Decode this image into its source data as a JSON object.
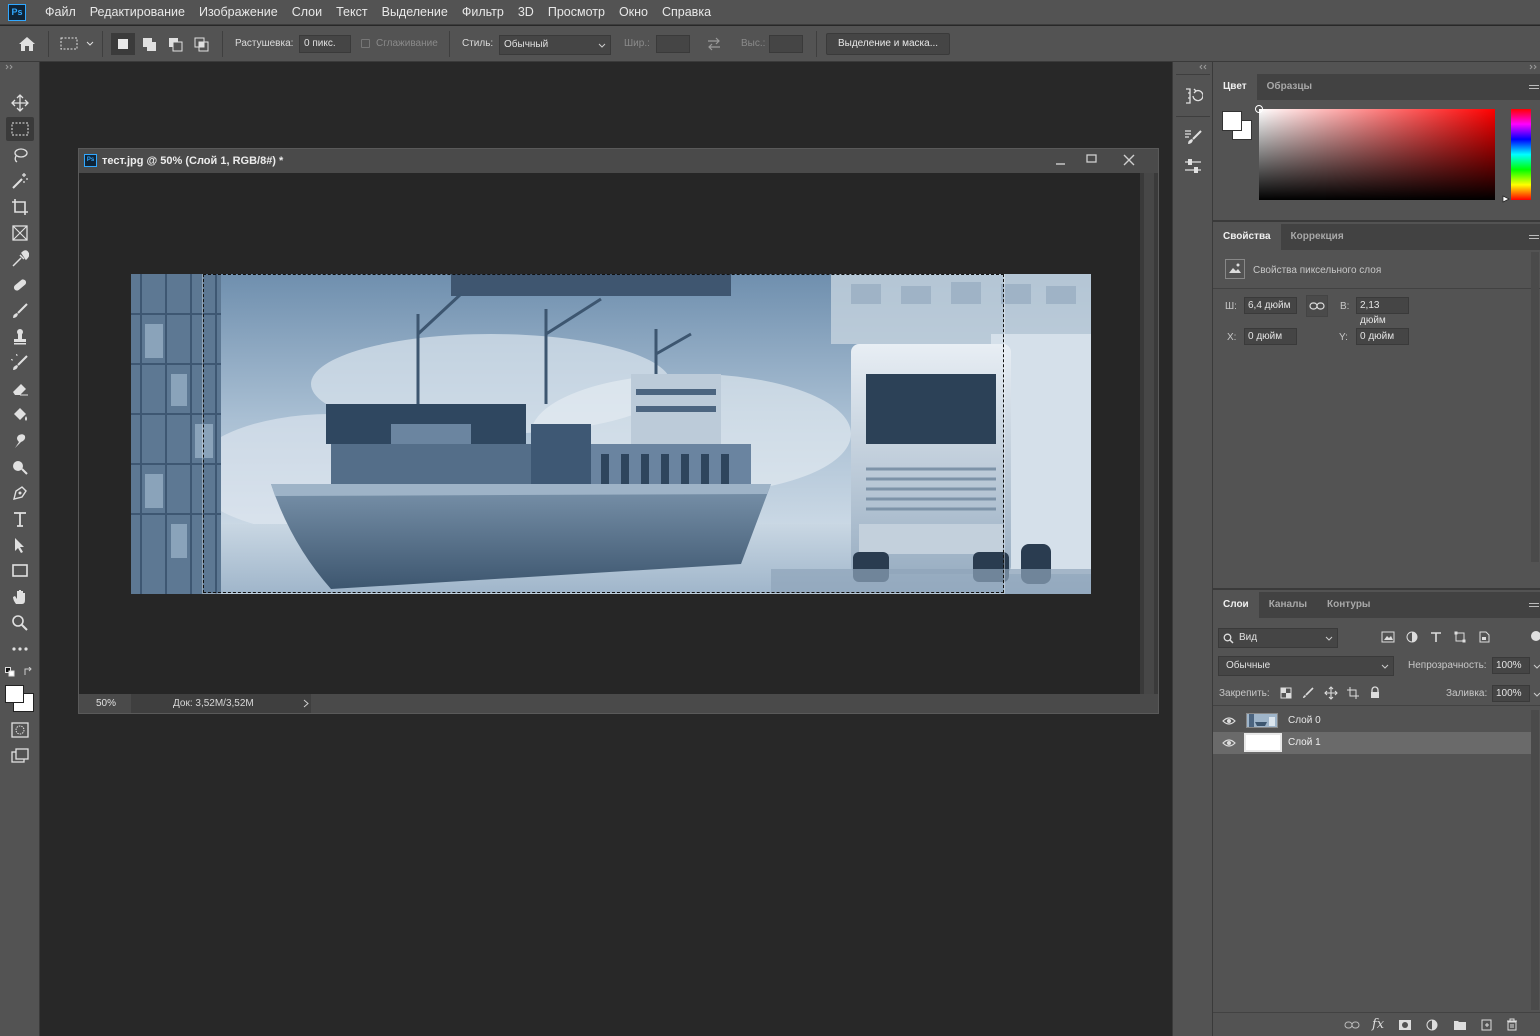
{
  "app": {
    "logo": "Ps"
  },
  "menu": [
    "Файл",
    "Редактирование",
    "Изображение",
    "Слои",
    "Текст",
    "Выделение",
    "Фильтр",
    "3D",
    "Просмотр",
    "Окно",
    "Справка"
  ],
  "options": {
    "feather_label": "Растушевка:",
    "feather_value": "0 пикс.",
    "antialias_label": "Сглаживание",
    "style_label": "Стиль:",
    "style_value": "Обычный",
    "width_label": "Шир.:",
    "height_label": "Выс.:",
    "select_mask_button": "Выделение и маска..."
  },
  "document": {
    "title": "тест.jpg @ 50% (Слой 1, RGB/8#) *",
    "zoom": "50%",
    "doc_info": "Док: 3,52M/3,52M"
  },
  "color_panel": {
    "tabs": [
      "Цвет",
      "Образцы"
    ]
  },
  "properties_panel": {
    "tabs": [
      "Свойства",
      "Коррекция"
    ],
    "header": "Свойства пиксельного слоя",
    "w_label": "Ш:",
    "w_value": "6,4 дюйм",
    "h_label": "В:",
    "h_value": "2,13 дюйм",
    "x_label": "X:",
    "x_value": "0 дюйм",
    "y_label": "Y:",
    "y_value": "0 дюйм"
  },
  "layers_panel": {
    "tabs": [
      "Слои",
      "Каналы",
      "Контуры"
    ],
    "filter_kind": "Вид",
    "blend_mode": "Обычные",
    "opacity_label": "Непрозрачность:",
    "opacity_value": "100%",
    "lock_label": "Закрепить:",
    "fill_label": "Заливка:",
    "fill_value": "100%",
    "layers": [
      {
        "name": "Слой 0",
        "selected": false
      },
      {
        "name": "Слой 1",
        "selected": true
      }
    ]
  },
  "colors": {
    "accent": "#31a8ff",
    "ui_dark": "#535353",
    "canvas_bg": "#282828"
  }
}
